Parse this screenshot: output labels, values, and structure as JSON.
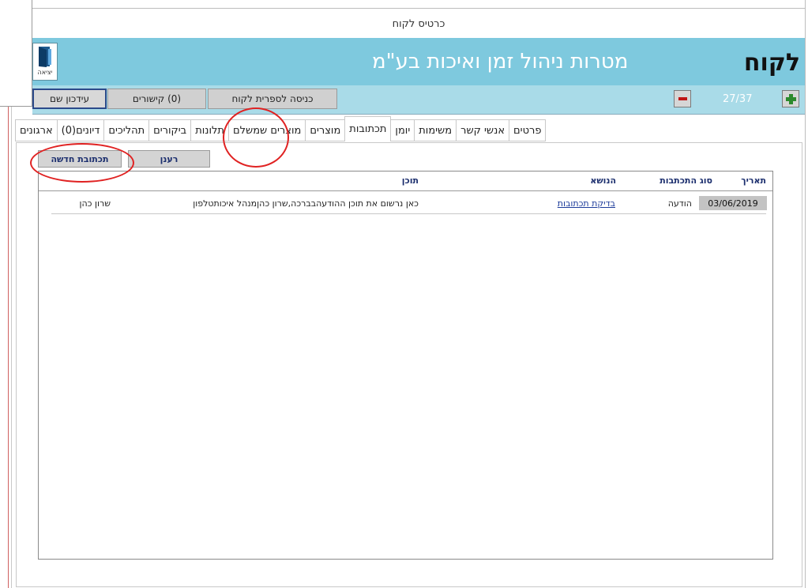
{
  "window": {
    "title": "כרטיס לקוח"
  },
  "header": {
    "exit_label": "יציאה",
    "company_name": "מטרות ניהול זמן ואיכות בע\"מ",
    "screen_title": "לקוח"
  },
  "toolbar": {
    "update_button": "עידכון שם",
    "links_button": "(0) קישורים",
    "library_button": "כניסה לספרית לקוח",
    "record_counter": "27/37"
  },
  "tabs": [
    {
      "label": "ארגונים",
      "active": false
    },
    {
      "label": "דיונים(0)",
      "active": false
    },
    {
      "label": "תהליכים",
      "active": false
    },
    {
      "label": "ביקורים",
      "active": false
    },
    {
      "label": "תלונות",
      "active": false
    },
    {
      "label": "מוצרים שמשלם",
      "active": false
    },
    {
      "label": "מוצרים",
      "active": false
    },
    {
      "label": "תכתובות",
      "active": true
    },
    {
      "label": "יומן",
      "active": false
    },
    {
      "label": "משימות",
      "active": false
    },
    {
      "label": "אנשי קשר",
      "active": false
    },
    {
      "label": "פרטים",
      "active": false
    }
  ],
  "actions": {
    "refresh": "רענן",
    "new_correspondence": "תכתובת חדשה"
  },
  "grid": {
    "columns": {
      "date": "תאריך",
      "type": "סוג התכתבות",
      "subject": "הנושא",
      "content": "תוכן"
    },
    "rows": [
      {
        "date": "03/06/2019",
        "type": "הודעה",
        "subject": "בדיקת תכתובות",
        "content": "כאן נרשום את תוכן ההודעהבברכה,שרון כהןמנהל איכותטלפון",
        "author": "שרון כהן"
      }
    ]
  },
  "colors": {
    "header_band": "#7ec9de",
    "toolbar": "#a9dbe8",
    "highlight_circle": "#e02222",
    "link": "#1c3b9a"
  }
}
